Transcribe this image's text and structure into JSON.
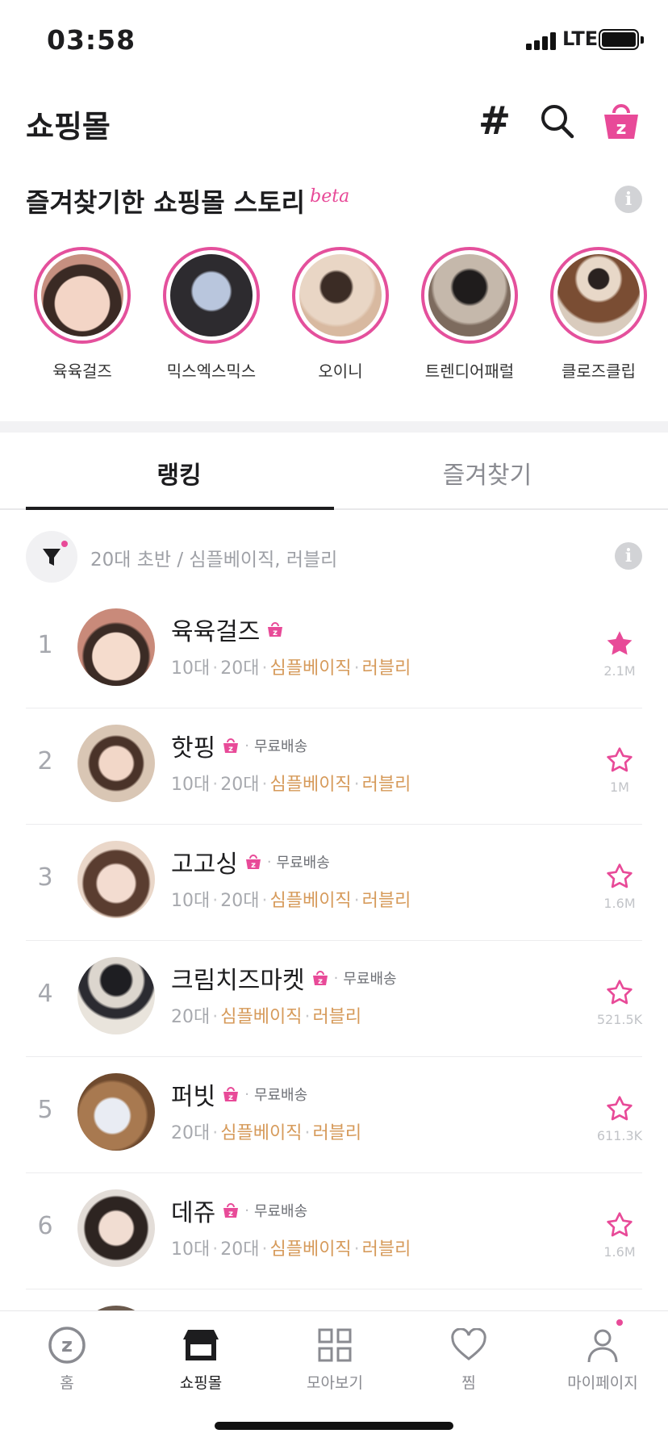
{
  "status_bar": {
    "time": "03:58",
    "network": "LTE"
  },
  "header": {
    "title": "쇼핑몰"
  },
  "stories": {
    "title": "즐겨찾기한 쇼핑몰 스토리",
    "beta": "beta",
    "items": [
      {
        "name": "육육걸즈"
      },
      {
        "name": "믹스엑스믹스"
      },
      {
        "name": "오이니"
      },
      {
        "name": "트렌디어패럴"
      },
      {
        "name": "클로즈클립"
      }
    ]
  },
  "tabs": [
    {
      "label": "랭킹",
      "active": true
    },
    {
      "label": "즐겨찾기",
      "active": false
    }
  ],
  "filter": {
    "text": "20대 초반 / 심플베이직, 러블리"
  },
  "ranking": [
    {
      "rank": "1",
      "name": "육육걸즈",
      "shipping": "",
      "ages": [
        "10대",
        "20대"
      ],
      "styles": [
        "심플베이직",
        "러블리"
      ],
      "favorites": "2.1M",
      "starred": true
    },
    {
      "rank": "2",
      "name": "핫핑",
      "shipping": "무료배송",
      "ages": [
        "10대",
        "20대"
      ],
      "styles": [
        "심플베이직",
        "러블리"
      ],
      "favorites": "1M",
      "starred": false
    },
    {
      "rank": "3",
      "name": "고고싱",
      "shipping": "무료배송",
      "ages": [
        "10대",
        "20대"
      ],
      "styles": [
        "심플베이직",
        "러블리"
      ],
      "favorites": "1.6M",
      "starred": false
    },
    {
      "rank": "4",
      "name": "크림치즈마켓",
      "shipping": "무료배송",
      "ages": [
        "20대"
      ],
      "styles": [
        "심플베이직",
        "러블리"
      ],
      "favorites": "521.5K",
      "starred": false
    },
    {
      "rank": "5",
      "name": "퍼빗",
      "shipping": "무료배송",
      "ages": [
        "20대"
      ],
      "styles": [
        "심플베이직",
        "러블리"
      ],
      "favorites": "611.3K",
      "starred": false
    },
    {
      "rank": "6",
      "name": "데쥬",
      "shipping": "무료배송",
      "ages": [
        "10대",
        "20대"
      ],
      "styles": [
        "심플베이직",
        "러블리"
      ],
      "favorites": "1.6M",
      "starred": false
    }
  ],
  "bottom_nav": [
    {
      "label": "홈",
      "icon": "zigzag-home-icon"
    },
    {
      "label": "쇼핑몰",
      "icon": "store-icon",
      "active": true
    },
    {
      "label": "모아보기",
      "icon": "grid-icon"
    },
    {
      "label": "찜",
      "icon": "heart-icon"
    },
    {
      "label": "마이페이지",
      "icon": "person-icon"
    }
  ],
  "colors": {
    "accent": "#e84a98",
    "tag": "#d69a5a"
  }
}
